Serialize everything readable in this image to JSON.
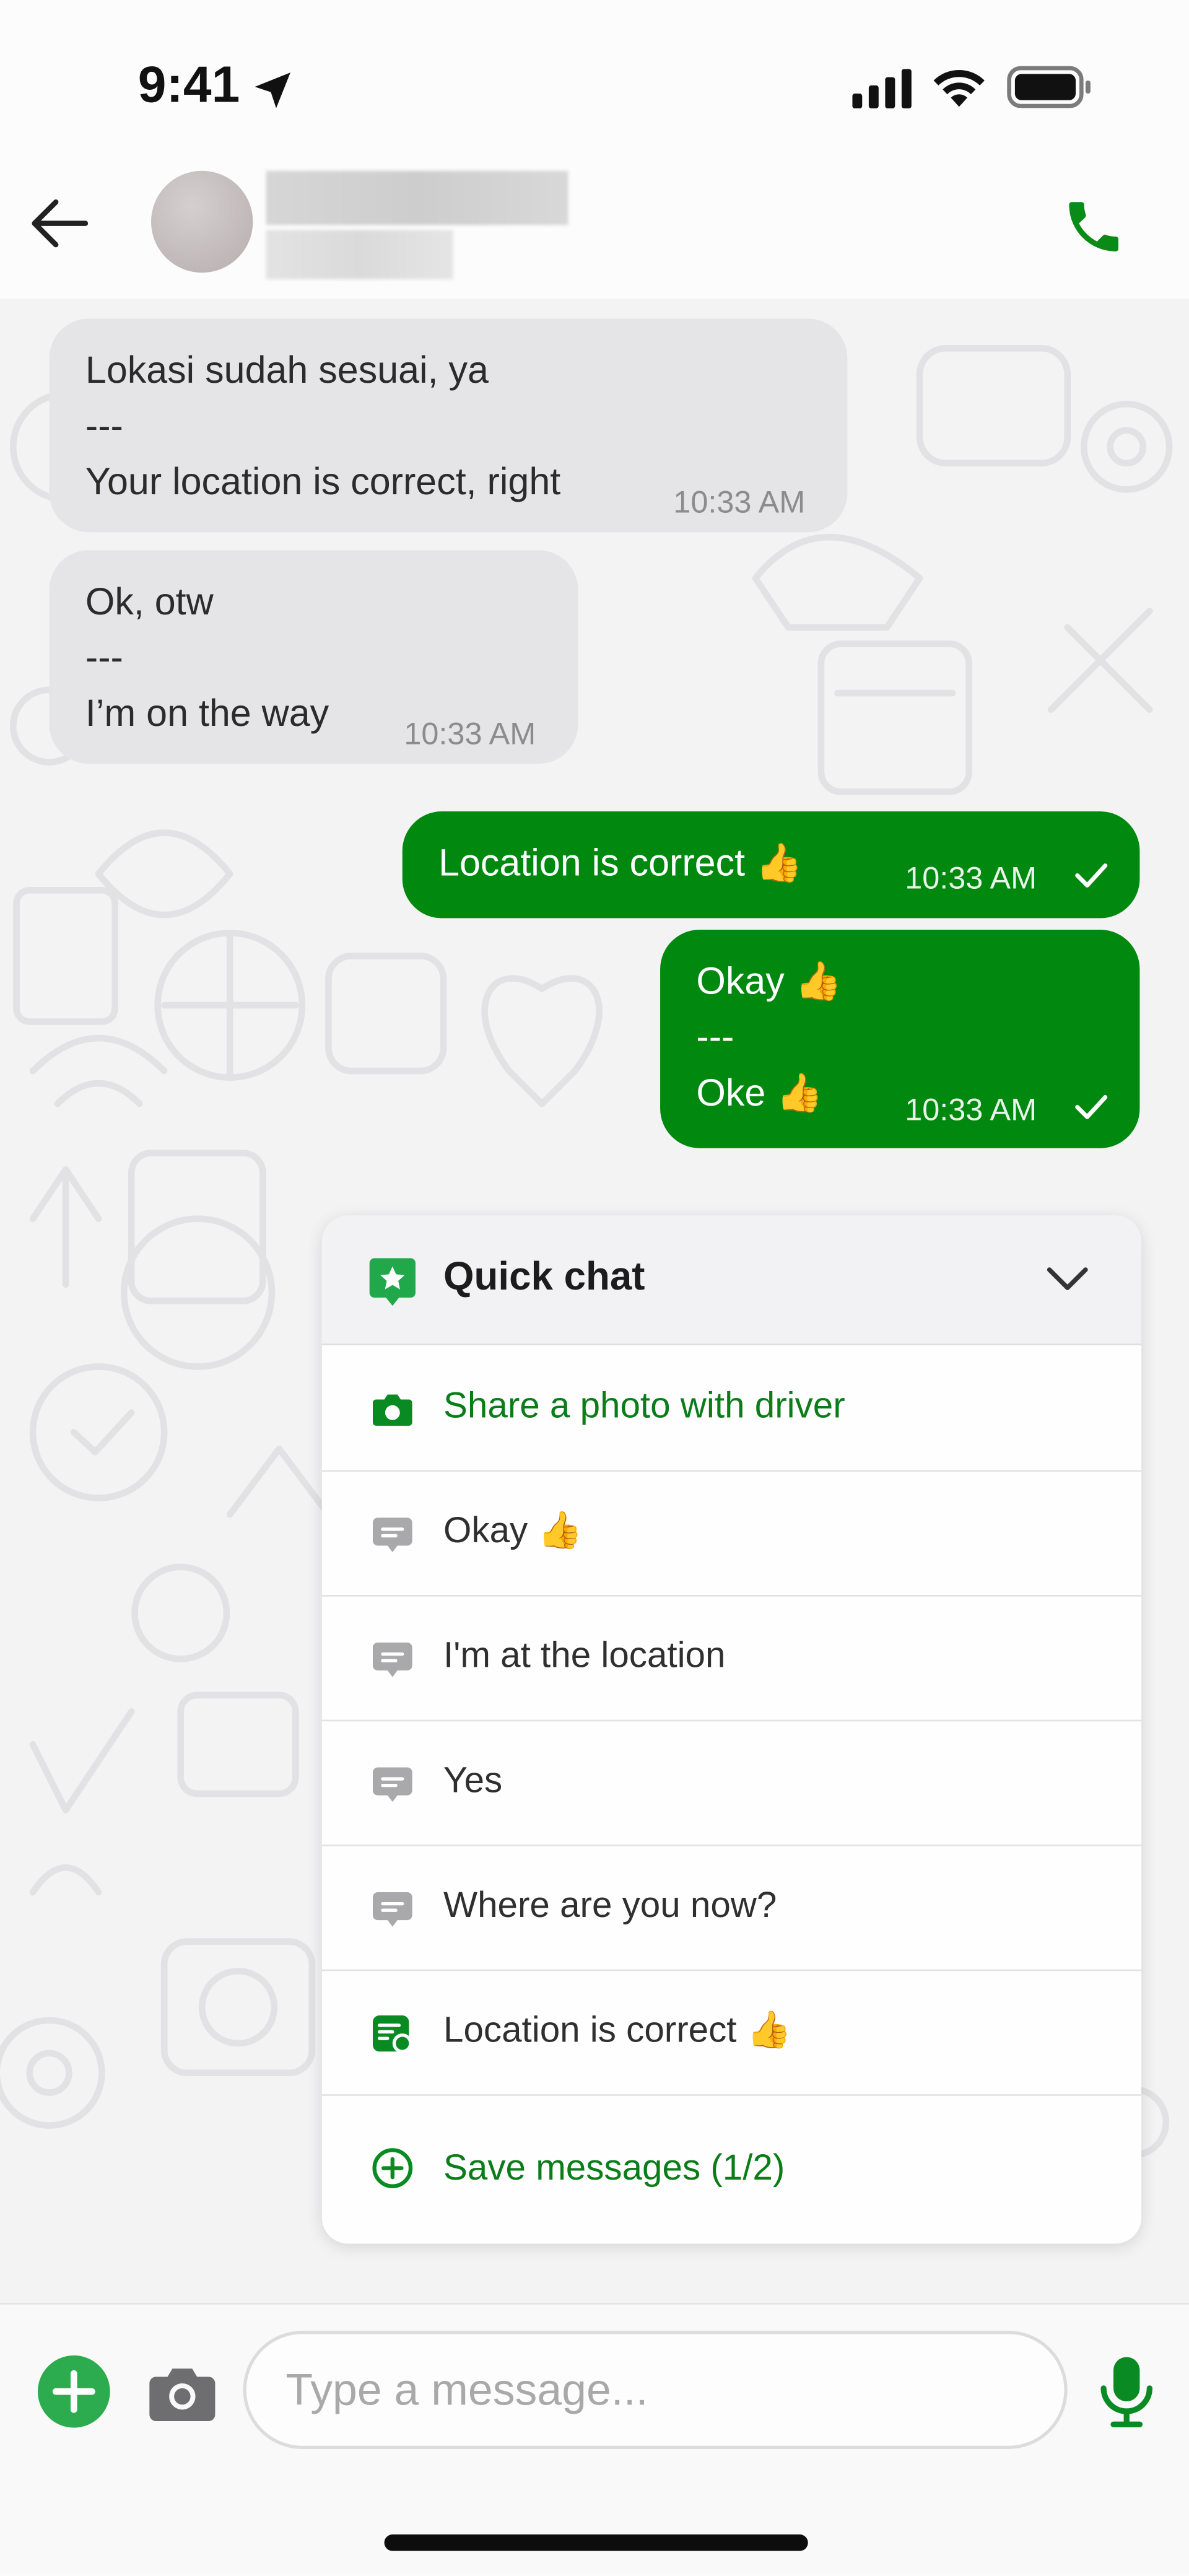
{
  "status_bar": {
    "time": "9:41"
  },
  "header": {
    "contact_name": "",
    "contact_subtitle": ""
  },
  "messages": [
    {
      "direction": "incoming",
      "lines": [
        "Lokasi sudah sesuai, ya",
        "---",
        "Your location is correct, right"
      ],
      "time": "10:33 AM"
    },
    {
      "direction": "incoming",
      "lines": [
        "Ok, otw",
        "---",
        "I’m on the way"
      ],
      "time": "10:33 AM"
    },
    {
      "direction": "outgoing",
      "lines": [
        "Location is correct 👍"
      ],
      "time": "10:33 AM",
      "status": "sent-check-icon"
    },
    {
      "direction": "outgoing",
      "lines": [
        "Okay 👍",
        "---",
        "Oke 👍"
      ],
      "time": "10:33 AM",
      "status": "sent-check-icon"
    }
  ],
  "quick_chat": {
    "title": "Quick chat",
    "items": [
      {
        "label": "Share a photo with driver",
        "icon": "camera-icon",
        "style": "action"
      },
      {
        "label": "Okay 👍",
        "icon": "chat-bubble-icon",
        "style": "preset"
      },
      {
        "label": "I'm at the location",
        "icon": "chat-bubble-icon",
        "style": "preset"
      },
      {
        "label": "Yes",
        "icon": "chat-bubble-icon",
        "style": "preset"
      },
      {
        "label": "Where are you now?",
        "icon": "chat-bubble-icon",
        "style": "preset"
      },
      {
        "label": "Location is correct 👍",
        "icon": "saved-message-icon",
        "style": "saved"
      },
      {
        "label": "Save messages (1/2)",
        "icon": "plus-circle-icon",
        "style": "action"
      }
    ]
  },
  "composer": {
    "placeholder": "Type a message..."
  },
  "colors": {
    "accent_green": "#00880f",
    "incoming_bubble": "#e5e4e6",
    "chat_background": "#f3f3f4"
  }
}
